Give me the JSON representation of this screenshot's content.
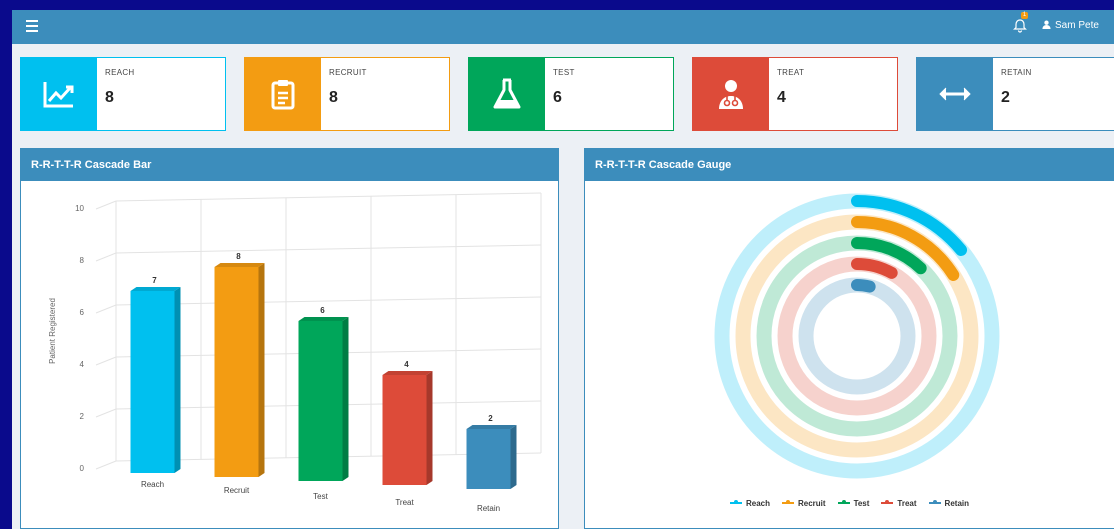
{
  "header": {
    "user_name": "Sam Pete",
    "notification_count": "1"
  },
  "kpis": [
    {
      "label": "REACH",
      "value": "8",
      "color": "#00c0ef",
      "icon": "trend-up-icon"
    },
    {
      "label": "RECRUIT",
      "value": "8",
      "color": "#f39c12",
      "icon": "clipboard-icon"
    },
    {
      "label": "TEST",
      "value": "6",
      "color": "#00a65a",
      "icon": "flask-icon"
    },
    {
      "label": "TREAT",
      "value": "4",
      "color": "#dd4b39",
      "icon": "doctor-icon"
    },
    {
      "label": "RETAIN",
      "value": "2",
      "color": "#3c8dbc",
      "icon": "arrows-horizontal-icon"
    }
  ],
  "bar_panel": {
    "title": "R-R-T-T-R Cascade Bar"
  },
  "gauge_panel": {
    "title": "R-R-T-T-R Cascade Gauge"
  },
  "chart_data": [
    {
      "type": "bar",
      "title": "",
      "ylabel": "Patient Registered",
      "xlabel": "",
      "categories": [
        "Reach",
        "Recruit",
        "Test",
        "Treat",
        "Retain"
      ],
      "values": [
        7,
        8,
        6,
        4,
        2
      ],
      "data_labels": [
        "7",
        "8",
        "6",
        "4",
        "2"
      ],
      "colors": [
        "#00c0ef",
        "#f39c12",
        "#00a65a",
        "#dd4b39",
        "#3c8dbc"
      ],
      "ylim": [
        0,
        10
      ],
      "yticks": [
        "0",
        "2",
        "4",
        "6",
        "8",
        "10"
      ],
      "grid": true
    },
    {
      "type": "radial-gauge",
      "series": [
        {
          "name": "Reach",
          "value": 7,
          "color": "#00c0ef"
        },
        {
          "name": "Recruit",
          "value": 8,
          "color": "#f39c12"
        },
        {
          "name": "Test",
          "value": 6,
          "color": "#00a65a"
        },
        {
          "name": "Treat",
          "value": 4,
          "color": "#dd4b39"
        },
        {
          "name": "Retain",
          "value": 2,
          "color": "#3c8dbc"
        }
      ],
      "legend": "bottom"
    }
  ]
}
